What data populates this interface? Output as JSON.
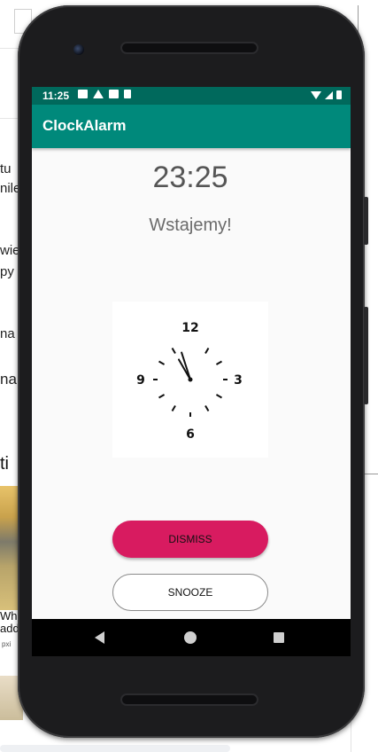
{
  "background": {
    "text_lines": [
      "tu",
      "nile",
      "wie",
      "py",
      "na",
      "na"
    ],
    "heading": "ti",
    "caption_lines": [
      "Whe",
      "add"
    ],
    "small_text": "pxi"
  },
  "device": {
    "status_bar": {
      "time": "11:25",
      "left_icons": [
        "mail-icon",
        "drive-icon",
        "calendar-icon",
        "sd-card-icon"
      ],
      "right_icons": [
        "wifi-icon",
        "signal-icon",
        "battery-icon"
      ]
    },
    "app_bar": {
      "title": "ClockAlarm"
    },
    "alarm": {
      "time": "23:25",
      "message": "Wstajemy!",
      "clock": {
        "numerals": [
          "12",
          "3",
          "6",
          "9"
        ],
        "hour_hand_angle_deg": 342,
        "minute_hand_angle_deg": 330
      }
    },
    "buttons": {
      "dismiss": "DISMISS",
      "snooze": "SNOOZE"
    },
    "nav_bar": [
      "back-icon",
      "home-icon",
      "recents-icon"
    ]
  },
  "colors": {
    "status_bar": "#00695c",
    "app_bar": "#00897b",
    "dismiss": "#d81b60"
  }
}
